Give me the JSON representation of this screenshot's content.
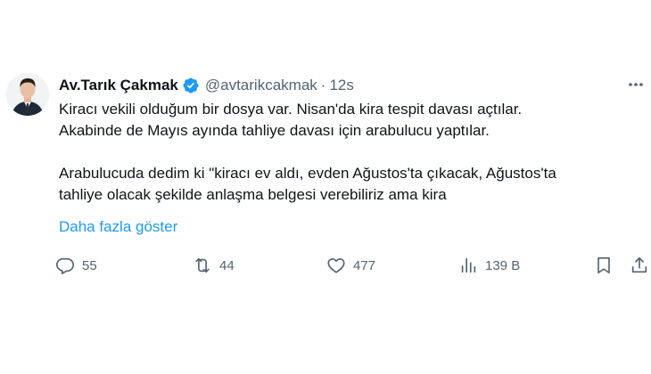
{
  "author": {
    "display_name": "Av.Tarık Çakmak",
    "handle": "@avtarikcakmak",
    "separator": "·",
    "time": "12s",
    "verified_color": "#1d9bf0"
  },
  "tweet": {
    "lines_paragraph1": [
      "Kiracı vekili olduğum bir dosya var. Nisan'da kira tespit davası açtılar.",
      "Akabinde de Mayıs ayında tahliye davası için arabulucu yaptılar."
    ],
    "lines_paragraph2": [
      "Arabulucuda dedim ki \"kiracı ev aldı, evden Ağustos'ta çıkacak, Ağustos'ta",
      "tahliye olacak şekilde anlaşma belgesi verebiliriz ama kira"
    ],
    "show_more": "Daha fazla göster"
  },
  "actions": {
    "reply": {
      "icon": "reply-icon",
      "count": "55"
    },
    "retweet": {
      "icon": "retweet-icon",
      "count": "44"
    },
    "like": {
      "icon": "like-icon",
      "count": "477"
    },
    "views": {
      "icon": "views-icon",
      "count": "139 B"
    },
    "bookmark": {
      "icon": "bookmark-icon"
    },
    "share": {
      "icon": "share-icon"
    }
  },
  "colors": {
    "text": "#0f1419",
    "secondary": "#536471",
    "link": "#1d9bf0"
  }
}
